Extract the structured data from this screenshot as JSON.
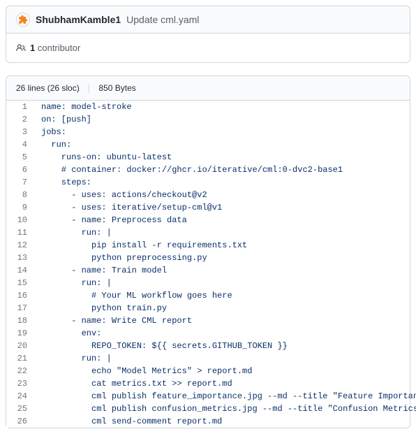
{
  "commit": {
    "author": "ShubhamKamble1",
    "message": "Update cml.yaml"
  },
  "contributors": {
    "count": "1",
    "label": "contributor"
  },
  "file_meta": {
    "lines_sloc": "26 lines (26 sloc)",
    "size": "850 Bytes"
  },
  "code_lines": [
    {
      "n": 1,
      "t": "name: model-stroke",
      "c": false
    },
    {
      "n": 2,
      "t": "on: [push]",
      "c": false
    },
    {
      "n": 3,
      "t": "jobs:",
      "c": false
    },
    {
      "n": 4,
      "t": "  run:",
      "c": false
    },
    {
      "n": 5,
      "t": "    runs-on: ubuntu-latest",
      "c": false
    },
    {
      "n": 6,
      "t": "    # container: docker://ghcr.io/iterative/cml:0-dvc2-base1",
      "c": true
    },
    {
      "n": 7,
      "t": "    steps:",
      "c": false
    },
    {
      "n": 8,
      "t": "      - uses: actions/checkout@v2",
      "c": false
    },
    {
      "n": 9,
      "t": "      - uses: iterative/setup-cml@v1",
      "c": false
    },
    {
      "n": 10,
      "t": "      - name: Preprocess data",
      "c": false
    },
    {
      "n": 11,
      "t": "        run: |",
      "c": false
    },
    {
      "n": 12,
      "t": "          pip install -r requirements.txt",
      "c": false
    },
    {
      "n": 13,
      "t": "          python preprocessing.py",
      "c": false
    },
    {
      "n": 14,
      "t": "      - name: Train model",
      "c": false
    },
    {
      "n": 15,
      "t": "        run: |",
      "c": false
    },
    {
      "n": 16,
      "t": "          # Your ML workflow goes here",
      "c": false
    },
    {
      "n": 17,
      "t": "          python train.py",
      "c": false
    },
    {
      "n": 18,
      "t": "      - name: Write CML report",
      "c": false
    },
    {
      "n": 19,
      "t": "        env:",
      "c": false
    },
    {
      "n": 20,
      "t": "          REPO_TOKEN: ${{ secrets.GITHUB_TOKEN }}",
      "c": false
    },
    {
      "n": 21,
      "t": "        run: |",
      "c": false
    },
    {
      "n": 22,
      "t": "          echo \"Model Metrics\" > report.md",
      "c": false
    },
    {
      "n": 23,
      "t": "          cat metrics.txt >> report.md",
      "c": false
    },
    {
      "n": 24,
      "t": "          cml publish feature_importance.jpg --md --title \"Feature Importance\" >> report.md",
      "c": false
    },
    {
      "n": 25,
      "t": "          cml publish confusion_metrics.jpg --md --title \"Confusion Metrics\" >> report.md",
      "c": false
    },
    {
      "n": 26,
      "t": "          cml send-comment report.md",
      "c": false
    }
  ]
}
